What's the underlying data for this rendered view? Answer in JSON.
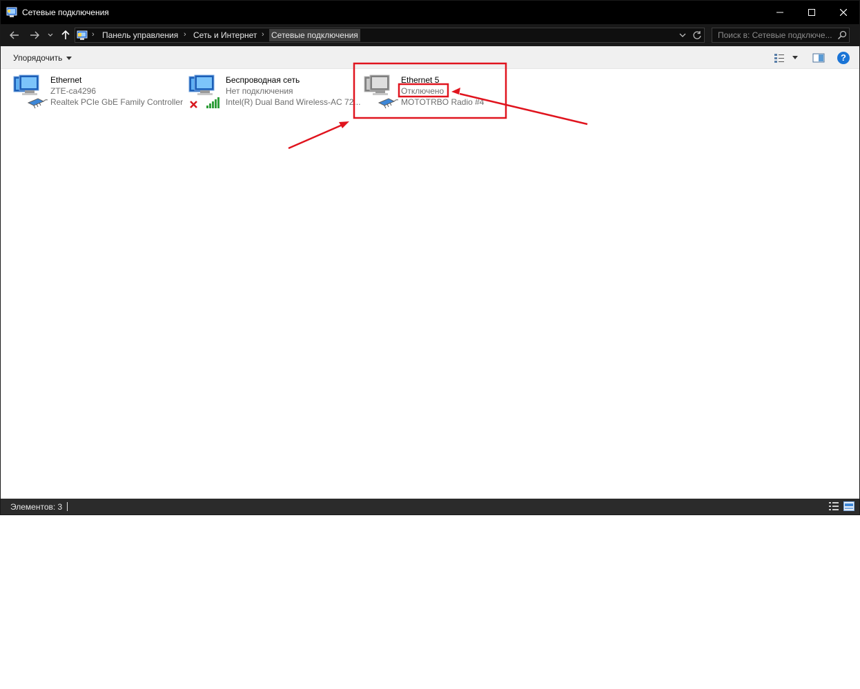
{
  "window": {
    "title": "Сетевые подключения"
  },
  "address_bar": {
    "breadcrumbs": [
      {
        "label": "Панель управления"
      },
      {
        "label": "Сеть и Интернет"
      },
      {
        "label": "Сетевые подключения"
      }
    ]
  },
  "search": {
    "placeholder": "Поиск в: Сетевые подключе..."
  },
  "toolbar": {
    "organize_label": "Упорядочить",
    "help_label": "?"
  },
  "connections": [
    {
      "name": "Ethernet",
      "status": "ZTE-ca4296",
      "device": "Realtek PCIe GbE Family Controller",
      "icon": "network-connected-icon"
    },
    {
      "name": "Беспроводная сеть",
      "status": "Нет подключения",
      "device": "Intel(R) Dual Band Wireless-AC 72...",
      "icon": "wireless-disconnected-icon"
    },
    {
      "name": "Ethernet 5",
      "status": "Отключено",
      "device": "MOTOTRBO Radio #4",
      "icon": "network-disabled-icon"
    }
  ],
  "statusbar": {
    "count_text": "Элементов: 3"
  },
  "colors": {
    "titlebar": "#000000",
    "navbar": "#191919",
    "annotation": "#e0141e",
    "help": "#1a74d6"
  }
}
